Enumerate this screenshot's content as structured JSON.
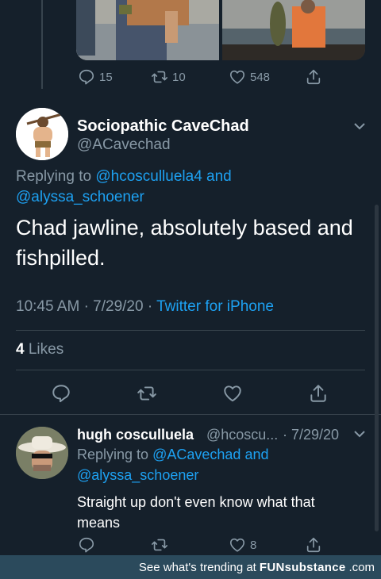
{
  "prev_tweet": {
    "reply_count": "15",
    "retweet_count": "10",
    "like_count": "548"
  },
  "main_tweet": {
    "display_name": "Sociopathic CaveChad",
    "handle": "@ACavechad",
    "replying_prefix": "Replying to",
    "replying_user1": "@hcosculluela4",
    "replying_and": "and",
    "replying_user2": "@alyssa_schoener",
    "text_line1": "Chad jawline, absolutely based and",
    "text_line2": "fishpilled.",
    "time": "10:45 AM",
    "date": "7/29/20",
    "source": "Twitter for iPhone",
    "likes_count": "4",
    "likes_label": "Likes"
  },
  "reply_tweet": {
    "display_name": "hugh cosculluela",
    "handle": "@hcoscu...",
    "date": "7/29/20",
    "replying_prefix": "Replying to",
    "replying_user1": "@ACavechad",
    "replying_and": "and",
    "replying_user2": "@alyssa_schoener",
    "text_line1": "Straight up don't even know what that",
    "text_line2": "means",
    "like_count": "8"
  },
  "footer": {
    "text": "See what's trending at",
    "brand": "FUNsubstance",
    "domain": ".com"
  },
  "icons": [
    "reply-icon",
    "retweet-icon",
    "like-icon",
    "share-icon",
    "chevron-down-icon"
  ]
}
